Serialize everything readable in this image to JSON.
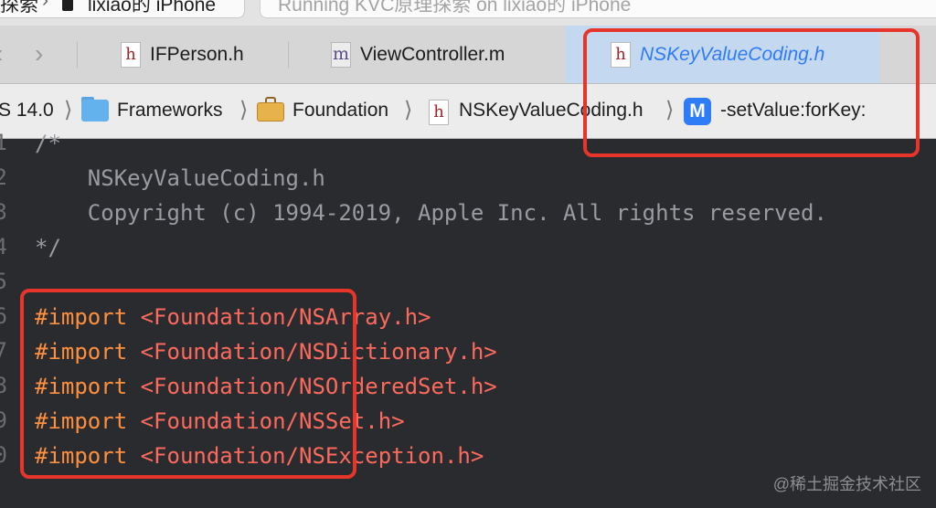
{
  "topbar": {
    "scheme": "探索",
    "scheme_chevron": "›",
    "device": "lixiao的 iPhone",
    "status": "Running KVC原理探索 on lixiao的 iPhone"
  },
  "tabs": {
    "back": "‹",
    "forward": "›",
    "items": [
      {
        "icon": "h",
        "label": "IFPerson.h"
      },
      {
        "icon": "m",
        "label": "ViewController.m"
      },
      {
        "icon": "h",
        "label": "NSKeyValueCoding.h"
      }
    ]
  },
  "jumpbar": {
    "sdk": "S 14.0",
    "frameworks": "Frameworks",
    "framework": "Foundation",
    "file": "NSKeyValueCoding.h",
    "method_badge": "M",
    "method": "-setValue:forKey:",
    "separator": "⟩"
  },
  "editor": {
    "line_numbers": [
      "1",
      "2",
      "3",
      "4",
      "5",
      "6",
      "7",
      "8",
      "9",
      "0"
    ],
    "comment_lines": [
      "/*",
      "    NSKeyValueCoding.h",
      "    Copyright (c) 1994-2019, Apple Inc. All rights reserved.",
      "*/"
    ],
    "imports": [
      {
        "directive": "#import",
        "path": "<Foundation/NSArray.h>"
      },
      {
        "directive": "#import",
        "path": "<Foundation/NSDictionary.h>"
      },
      {
        "directive": "#import",
        "path": "<Foundation/NSOrderedSet.h>"
      },
      {
        "directive": "#import",
        "path": "<Foundation/NSSet.h>"
      },
      {
        "directive": "#import",
        "path": "<Foundation/NSException.h>"
      }
    ]
  },
  "watermark": "@稀土掘金技术社区",
  "colors": {
    "annotation_red": "#e8352b",
    "preprocessor": "#fd8f3f",
    "string": "#fc6a5d",
    "comment": "#9a9ba0",
    "active_tab": "#2f7cf6"
  }
}
